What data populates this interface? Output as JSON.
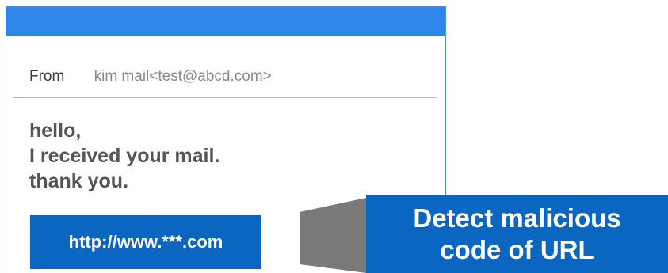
{
  "mail": {
    "from_label": "From",
    "from_value": "kim mail<test@abcd.com>",
    "body_lines": [
      "hello,",
      "I received your mail.",
      "thank you."
    ],
    "link_text": "http://www.***.com"
  },
  "callout": {
    "lines": [
      "Detect malicious",
      "code of URL"
    ]
  },
  "colors": {
    "titlebar": "#2f86e8",
    "accent": "#0b66c2",
    "callout_connector": "#7a7a7a"
  }
}
